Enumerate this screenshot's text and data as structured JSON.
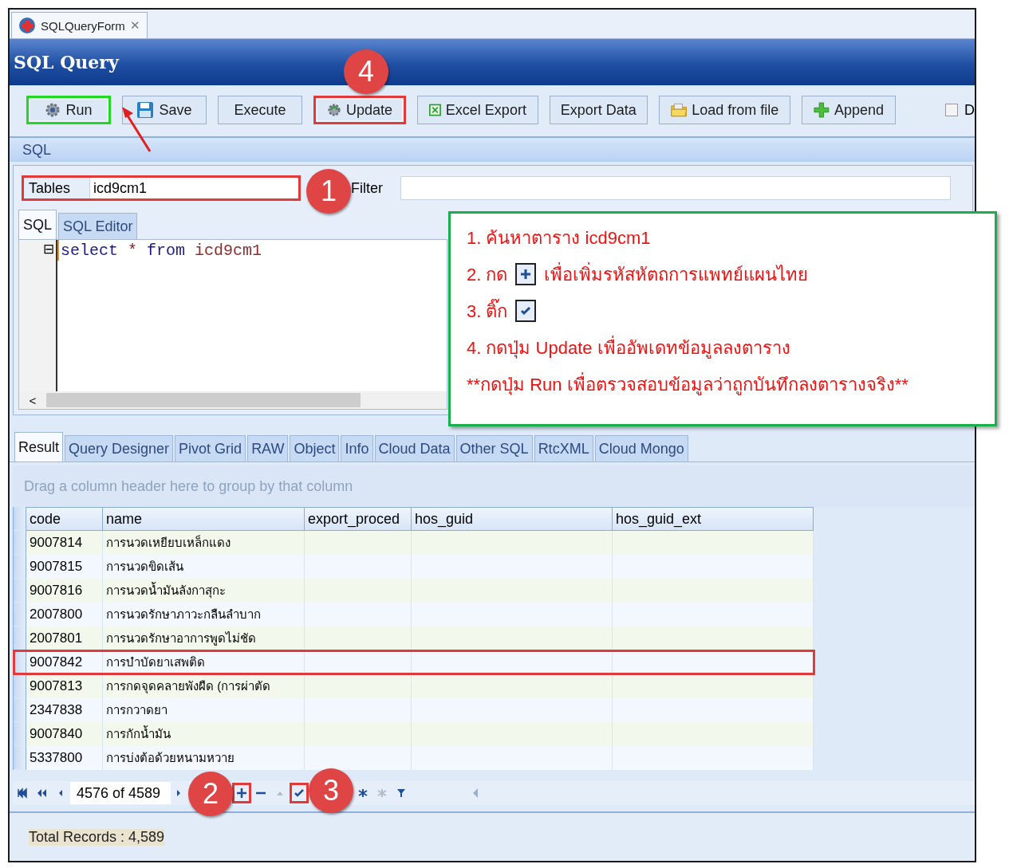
{
  "doc_tab": {
    "title": "SQLQueryForm",
    "close": "✕"
  },
  "window": {
    "title": "SQL Query"
  },
  "toolbar": [
    {
      "label": "Run",
      "color": "#22d822"
    },
    {
      "label": "Save"
    },
    {
      "label": "Execute"
    },
    {
      "label": "Update",
      "color": "#e03a3a"
    },
    {
      "label": "Excel Export"
    },
    {
      "label": "Export Data"
    },
    {
      "label": "Load from file"
    },
    {
      "label": "Append"
    }
  ],
  "toolbar_checkbox": {
    "label": "D",
    "checked": false
  },
  "sql_group": {
    "title": "SQL"
  },
  "tables": {
    "label": "Tables",
    "value": "icd9cm1",
    "highlighted": true
  },
  "filter": {
    "label": "Filter"
  },
  "editor_tabs": [
    {
      "label": "SQL",
      "selected": true
    },
    {
      "label": "SQL Editor",
      "selected": false
    }
  ],
  "editor": {
    "tokens": [
      {
        "text": "select",
        "kind": "keyword"
      },
      {
        "text": "*",
        "kind": "operator"
      },
      {
        "text": "from",
        "kind": "keyword"
      },
      {
        "text": "icd9cm1",
        "kind": "identifier"
      }
    ],
    "collapse": "⊟",
    "scroll_left": "<"
  },
  "result_tabs": [
    {
      "label": "Result",
      "selected": true
    },
    {
      "label": "Query Designer",
      "selected": false
    },
    {
      "label": "Pivot Grid",
      "selected": false
    },
    {
      "label": "RAW",
      "selected": false
    },
    {
      "label": "Object",
      "selected": false
    },
    {
      "label": "Info",
      "selected": false
    },
    {
      "label": "Cloud Data",
      "selected": false
    },
    {
      "label": "Other SQL",
      "selected": false
    },
    {
      "label": "RtcXML",
      "selected": false
    },
    {
      "label": "Cloud Mongo",
      "selected": false
    }
  ],
  "group_panel": {
    "hint": "Drag a column header here to group by that column"
  },
  "table": {
    "columns": [
      "code",
      "name",
      "export_proced",
      "hos_guid",
      "hos_guid_ext"
    ],
    "rows": [
      {
        "code": "9007814",
        "name": "การนวดเหยียบเหล็กแดง",
        "selected": false
      },
      {
        "code": "9007815",
        "name": "การนวดขิดเส้น",
        "selected": false
      },
      {
        "code": "9007816",
        "name": "การนวดน้ำมันลังกาสุกะ",
        "selected": false
      },
      {
        "code": "2007800",
        "name": "การนวดรักษาภาวะกลืนลำบาก",
        "selected": false
      },
      {
        "code": "2007801",
        "name": "การนวดรักษาอาการพูดไม่ชัด",
        "selected": false
      },
      {
        "code": "9007842",
        "name": "การบำบัดยาเสพติด",
        "selected": true
      },
      {
        "code": "9007813",
        "name": "การกดจุดคลายพังผืด (การผ่าตัด",
        "selected": false
      },
      {
        "code": "2347838",
        "name": "การกวาดยา",
        "selected": false
      },
      {
        "code": "9007840",
        "name": "การกักน้ำมัน",
        "selected": false
      },
      {
        "code": "5337800",
        "name": "การบ่งต้อด้วยหนามหวาย",
        "selected": false
      }
    ]
  },
  "navigator": {
    "position": "4576 of 4589",
    "buttons": [
      {
        "kind": "first",
        "highlighted": false,
        "disabled": false
      },
      {
        "kind": "prev-page",
        "highlighted": false,
        "disabled": false
      },
      {
        "kind": "prev",
        "highlighted": false,
        "disabled": false
      },
      {
        "kind": "next",
        "highlighted": false,
        "disabled": false
      },
      {
        "kind": "append",
        "highlighted": true,
        "disabled": false
      },
      {
        "kind": "remove",
        "highlighted": false,
        "disabled": false
      },
      {
        "kind": "edit",
        "highlighted": false,
        "disabled": true
      },
      {
        "kind": "end-edit",
        "highlighted": true,
        "disabled": false
      },
      {
        "kind": "refresh",
        "highlighted": false,
        "disabled": false
      },
      {
        "kind": "save-bookmark",
        "highlighted": false,
        "disabled": true
      },
      {
        "kind": "filter",
        "highlighted": false,
        "disabled": false
      }
    ]
  },
  "status_bar": {
    "text": "Total Records : 4,589"
  },
  "markers": [
    "1",
    "2",
    "3",
    "4"
  ],
  "callout": {
    "lines": [
      {
        "text": "1. ค้นหาตาราง icd9cm1"
      },
      {
        "text": "2. กด",
        "after": "เพื่อเพิ่มรหัสหัตถการแพทย์แผนไทย"
      },
      {
        "text": "3. ติ๊ก"
      },
      {
        "text": "4. กดปุ่ม Update เพื่ออัพเดทข้อมูลลงตาราง"
      },
      {
        "text": "**กดปุ่ม Run เพื่อตรวจสอบข้อมูลว่าถูกบันทึกลงตารางจริง**"
      }
    ]
  }
}
